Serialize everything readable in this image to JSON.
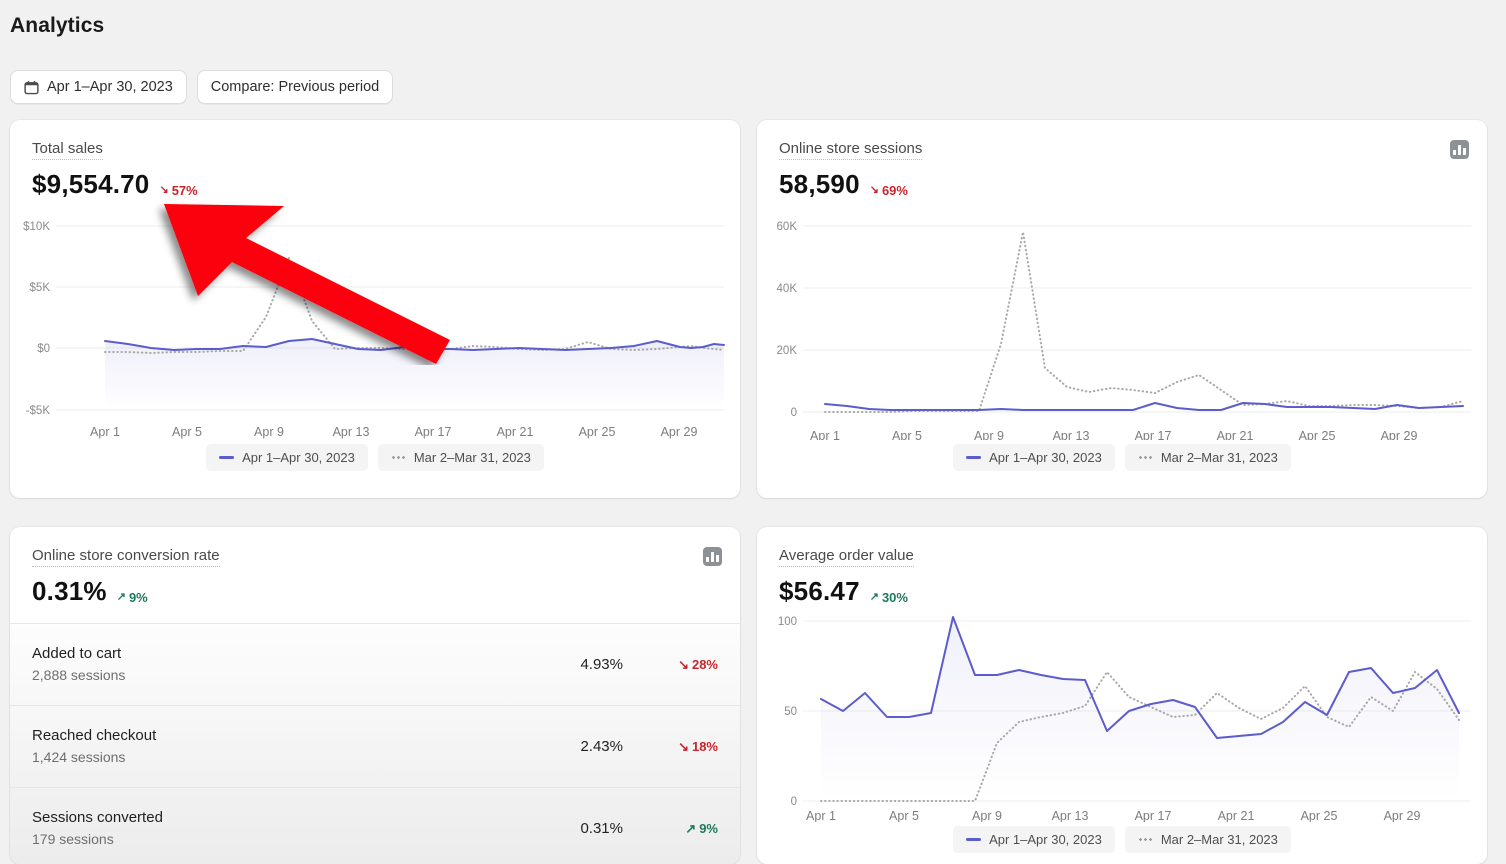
{
  "header": {
    "title": "Analytics",
    "date_range_label": "Apr 1–Apr 30, 2023",
    "compare_label": "Compare: Previous period",
    "calendar_icon": "calendar-icon"
  },
  "legend": {
    "current_label": "Apr 1–Apr 30, 2023",
    "compare_label": "Mar 2–Mar 31, 2023"
  },
  "colors": {
    "series": "#5c5ccd",
    "compare": "#a8a8a8",
    "negative": "#c9252d",
    "positive": "#1f7a5c",
    "page_bg": "#f1f1f1",
    "card_bg": "#ffffff",
    "annotation_arrow": "#fb0007"
  },
  "cards": {
    "total_sales": {
      "title": "Total sales",
      "value": "$9,554.70",
      "delta": "57%",
      "delta_direction": "down",
      "delta_arrow": "↘"
    },
    "sessions": {
      "title": "Online store sessions",
      "value": "58,590",
      "delta": "69%",
      "delta_direction": "down",
      "delta_arrow": "↘",
      "icon": "bar-chart-icon"
    },
    "conversion": {
      "title": "Online store conversion rate",
      "value": "0.31%",
      "delta": "9%",
      "delta_direction": "up",
      "delta_arrow": "↗",
      "icon": "bar-chart-icon",
      "rows": [
        {
          "name": "Added to cart",
          "sub": "2,888 sessions",
          "rate": "4.93%",
          "delta": "28%",
          "delta_direction": "down",
          "delta_arrow": "↘"
        },
        {
          "name": "Reached checkout",
          "sub": "1,424 sessions",
          "rate": "2.43%",
          "delta": "18%",
          "delta_direction": "down",
          "delta_arrow": "↘"
        },
        {
          "name": "Sessions converted",
          "sub": "179 sessions",
          "rate": "0.31%",
          "delta": "9%",
          "delta_direction": "up",
          "delta_arrow": "↗"
        }
      ]
    },
    "aov": {
      "title": "Average order value",
      "value": "$56.47",
      "delta": "30%",
      "delta_direction": "up",
      "delta_arrow": "↗"
    }
  },
  "annotation": {
    "name": "red-arrow-annotation",
    "points_to": "total-sales-chart"
  },
  "chart_data": [
    {
      "id": "total_sales",
      "type": "line",
      "title": "Total sales",
      "xlabel": "",
      "ylabel": "",
      "ylim": [
        -5000,
        10000
      ],
      "yticks": [
        10000,
        5000,
        0,
        -5000
      ],
      "ytick_labels": [
        "$10K",
        "$5K",
        "$0",
        "-$5K"
      ],
      "xticks": [
        1,
        5,
        9,
        13,
        17,
        21,
        25,
        29
      ],
      "xtick_labels": [
        "Apr 1",
        "Apr 5",
        "Apr 9",
        "Apr 13",
        "Apr 17",
        "Apr 21",
        "Apr 25",
        "Apr 29"
      ],
      "grid": true,
      "legend_position": "bottom",
      "series": [
        {
          "name": "Apr 1–Apr 30, 2023",
          "style": "solid",
          "color": "#5c5ccd",
          "values": [
            900,
            750,
            480,
            300,
            340,
            330,
            420,
            400,
            600,
            650,
            520,
            330,
            300,
            380,
            330,
            330,
            300,
            330,
            360,
            330,
            300,
            330,
            360,
            420,
            620,
            400,
            380,
            420,
            520,
            480
          ]
        },
        {
          "name": "Mar 2–Mar 31, 2023",
          "style": "dotted",
          "color": "#a8a8a8",
          "values": [
            60,
            50,
            40,
            60,
            70,
            80,
            90,
            2800,
            7600,
            2500,
            300,
            340,
            360,
            330,
            300,
            330,
            450,
            400,
            330,
            300,
            330,
            500,
            330,
            300,
            330,
            400,
            430,
            380,
            320,
            300
          ]
        }
      ]
    },
    {
      "id": "sessions",
      "type": "line",
      "title": "Online store sessions",
      "xlabel": "",
      "ylabel": "",
      "ylim": [
        0,
        60000
      ],
      "yticks": [
        60000,
        40000,
        20000,
        0
      ],
      "ytick_labels": [
        "60K",
        "40K",
        "20K",
        "0"
      ],
      "xticks": [
        1,
        5,
        9,
        13,
        17,
        21,
        25,
        29
      ],
      "xtick_labels": [
        "Apr 1",
        "Apr 5",
        "Apr 9",
        "Apr 13",
        "Apr 17",
        "Apr 21",
        "Apr 25",
        "Apr 29"
      ],
      "grid": true,
      "legend_position": "bottom",
      "series": [
        {
          "name": "Apr 1–Apr 30, 2023",
          "style": "solid",
          "color": "#5c5ccd",
          "values": [
            2600,
            2100,
            900,
            700,
            700,
            700,
            700,
            700,
            900,
            800,
            700,
            700,
            700,
            700,
            700,
            3000,
            1000,
            700,
            700,
            3000,
            2600,
            1400,
            1400,
            1400,
            1200,
            1000,
            2200,
            1200,
            1400,
            1600
          ]
        },
        {
          "name": "Mar 2–Mar 31, 2023",
          "style": "dotted",
          "color": "#a8a8a8",
          "values": [
            200,
            200,
            200,
            200,
            250,
            250,
            250,
            250,
            22000,
            58000,
            24000,
            8000,
            6500,
            8000,
            7000,
            6000,
            9500,
            12000,
            7000,
            2500,
            2300,
            3500,
            2000,
            2000,
            2200,
            2300,
            2000,
            1200,
            1400,
            3500
          ]
        }
      ]
    },
    {
      "id": "average_order_value",
      "type": "line",
      "title": "Average order value",
      "xlabel": "",
      "ylabel": "",
      "ylim": [
        0,
        110
      ],
      "yticks": [
        100,
        50,
        0
      ],
      "ytick_labels": [
        "100",
        "50",
        "0"
      ],
      "xticks": [
        1,
        5,
        9,
        13,
        17,
        21,
        25,
        29
      ],
      "xtick_labels": [
        "Apr 1",
        "Apr 5",
        "Apr 9",
        "Apr 13",
        "Apr 17",
        "Apr 21",
        "Apr 25",
        "Apr 29"
      ],
      "grid": true,
      "legend_position": "bottom",
      "series": [
        {
          "name": "Apr 1–Apr 30, 2023",
          "style": "solid",
          "color": "#5c5ccd",
          "values": [
            57,
            50,
            60,
            47,
            47,
            49,
            102,
            70,
            70,
            73,
            70,
            68,
            67,
            39,
            50,
            54,
            56,
            52,
            35,
            36,
            37,
            44,
            55,
            48,
            72,
            74,
            60,
            63,
            73,
            49
          ]
        },
        {
          "name": "Mar 2–Mar 31, 2023",
          "style": "dotted",
          "color": "#a8a8a8",
          "values": [
            0,
            0,
            0,
            0,
            0,
            0,
            0,
            0,
            32,
            44,
            47,
            49,
            53,
            72,
            58,
            53,
            47,
            48,
            60,
            52,
            46,
            52,
            64,
            47,
            41,
            58,
            50,
            72,
            62,
            45
          ]
        }
      ]
    }
  ]
}
